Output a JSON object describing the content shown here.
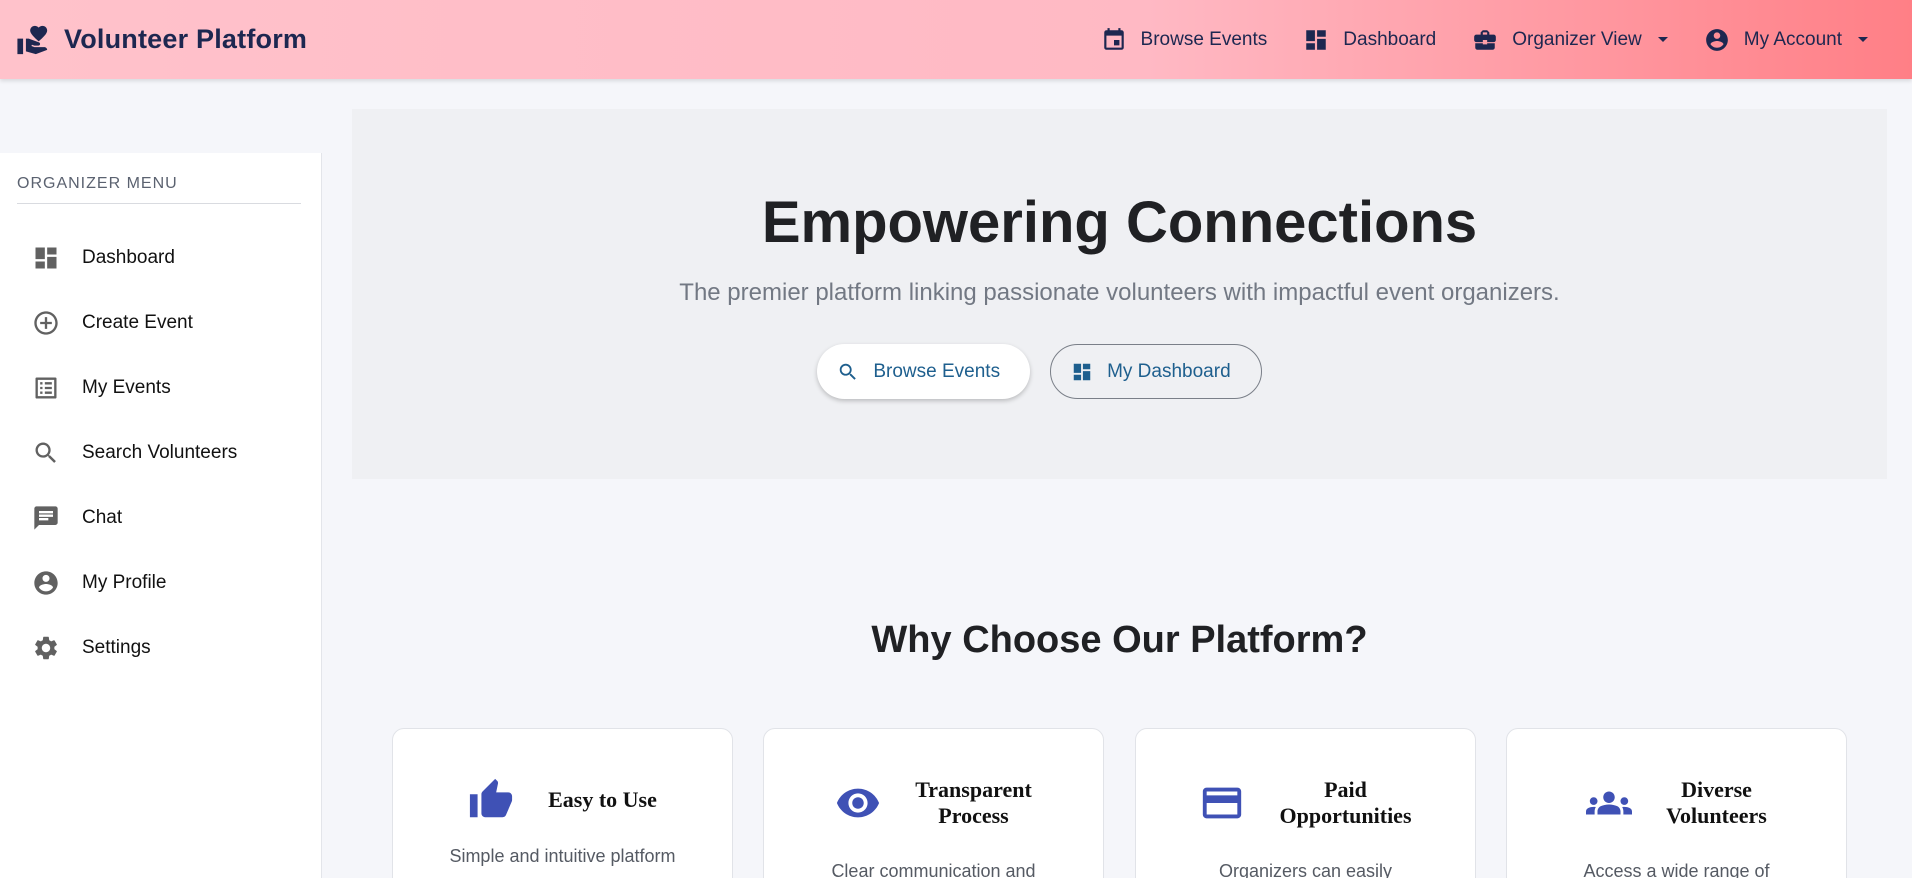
{
  "app": {
    "title": "Volunteer Platform"
  },
  "nav": {
    "browse_events": "Browse Events",
    "dashboard": "Dashboard",
    "organizer_view": "Organizer View",
    "my_account": "My Account"
  },
  "sidebar": {
    "heading": "ORGANIZER MENU",
    "items": [
      {
        "label": "Dashboard",
        "icon": "dashboard-icon"
      },
      {
        "label": "Create Event",
        "icon": "add-circle-icon"
      },
      {
        "label": "My Events",
        "icon": "list-icon"
      },
      {
        "label": "Search Volunteers",
        "icon": "search-icon"
      },
      {
        "label": "Chat",
        "icon": "chat-icon"
      },
      {
        "label": "My Profile",
        "icon": "account-circle-icon"
      },
      {
        "label": "Settings",
        "icon": "gear-icon"
      }
    ]
  },
  "hero": {
    "title": "Empowering Connections",
    "subtitle": "The premier platform linking passionate volunteers with impactful event organizers.",
    "primary_button": "Browse Events",
    "secondary_button": "My Dashboard"
  },
  "features": {
    "title": "Why Choose Our Platform?",
    "cards": [
      {
        "title_line1": "Easy to Use",
        "title_line2": "",
        "desc": "Simple and intuitive platform",
        "icon": "thumbs-up-icon"
      },
      {
        "title_line1": "Transparent",
        "title_line2": "Process",
        "desc": "Clear communication and",
        "icon": "eye-icon"
      },
      {
        "title_line1": "Paid",
        "title_line2": "Opportunities",
        "desc": "Organizers can easily",
        "icon": "credit-card-icon"
      },
      {
        "title_line1": "Diverse",
        "title_line2": "Volunteers",
        "desc": "Access a wide range of",
        "icon": "groups-icon"
      }
    ]
  },
  "colors": {
    "topbar_start": "#ffc2cb",
    "topbar_end": "#ff7f86",
    "navy": "#1d2750",
    "accent_blue": "#3f51b5",
    "button_text": "#1e5f8e"
  }
}
